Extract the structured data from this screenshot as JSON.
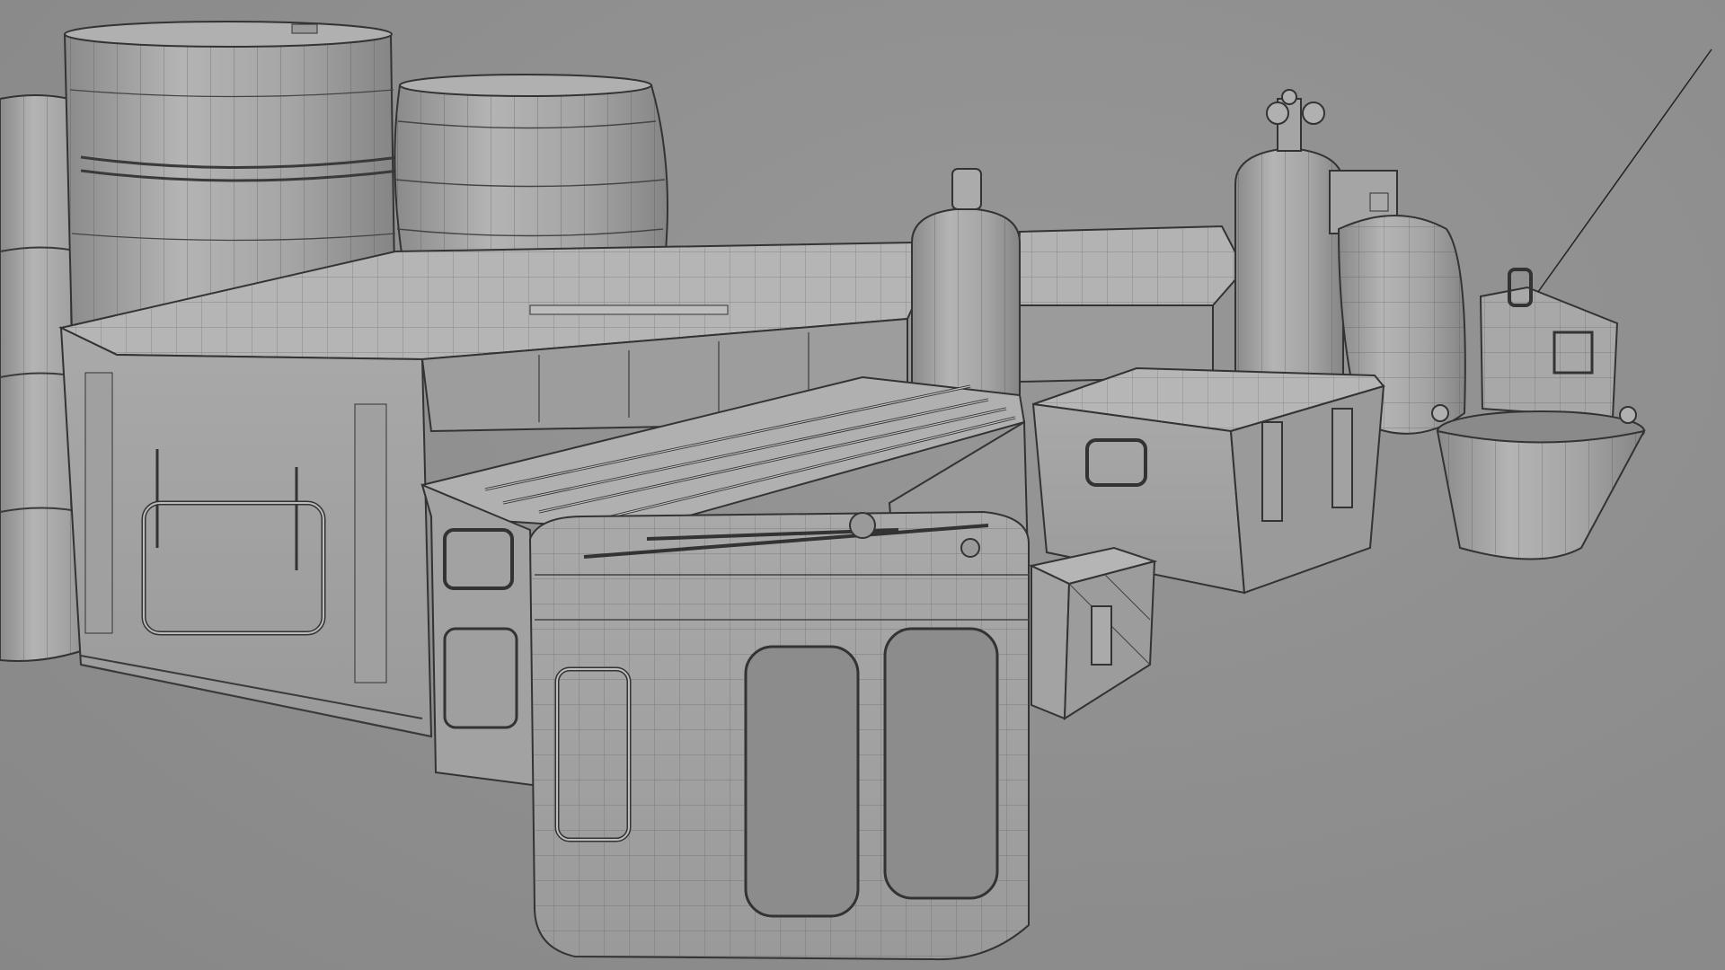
{
  "scene": {
    "background_color": "#8f8f8f",
    "mesh_fill": "#a6a6a6",
    "mesh_shade": "#8a8a8a",
    "wire_color": "#3a3a3a",
    "objects": [
      "barrel-left-icon",
      "barrel-steel-icon",
      "barrel-wood-icon",
      "crate-large-icon",
      "crate-back-icon",
      "gas-cylinder-tall-icon",
      "gas-cylinder-valve-icon",
      "propane-tank-icon",
      "ammo-box-icon",
      "bucket-icon",
      "case-medium-icon",
      "crate-rounded-icon",
      "toolbox-small-icon",
      "container-rounded-icon"
    ]
  }
}
